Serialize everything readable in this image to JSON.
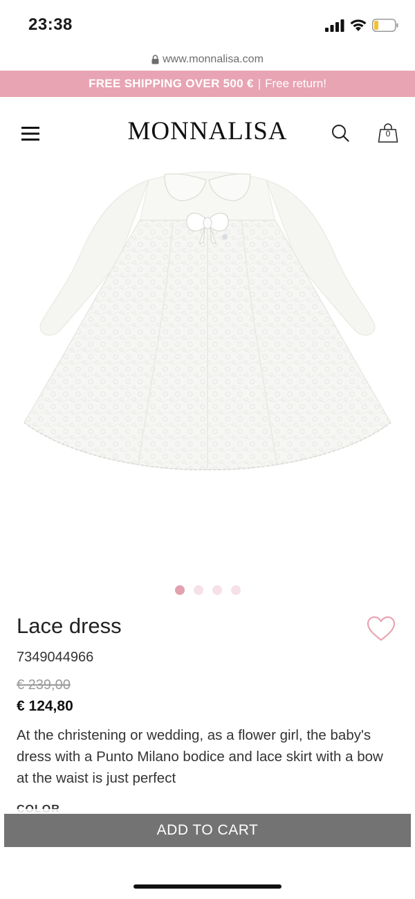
{
  "status_bar": {
    "time": "23:38",
    "icons": [
      "signal-icon",
      "wifi-icon",
      "battery-icon"
    ]
  },
  "browser": {
    "url": "www.monnalisa.com",
    "icon": "lock-icon"
  },
  "promo": {
    "bold_text": "FREE SHIPPING OVER 500 €",
    "separator": "|",
    "text": "Free return!",
    "background_color": "#e8a4b3"
  },
  "header": {
    "brand": "MONNALISA",
    "icons": [
      "menu-icon",
      "search-icon",
      "shopping-bag-icon"
    ],
    "bag_count": "0"
  },
  "product": {
    "image_alt": "white long-sleeve baby dress with lace skirt and satin bow",
    "carousel": {
      "total": 4,
      "active": 1,
      "active_color": "#e3a1b0",
      "inactive_color": "#f6e1e7"
    },
    "title": "Lace dress",
    "sku": "7349044966",
    "old_price": "€ 239,00",
    "price": "€ 124,80",
    "description": "At the christening or wedding, as a flower girl, the baby's dress with a Punto Milano bodice and lace skirt with a bow at the waist is just perfect",
    "color_label": "COLOR",
    "wishlist_icon": "heart-icon",
    "wishlist_color": "#e8a4b3"
  },
  "cart": {
    "add_label": "ADD TO CART",
    "button_color": "#737373"
  }
}
